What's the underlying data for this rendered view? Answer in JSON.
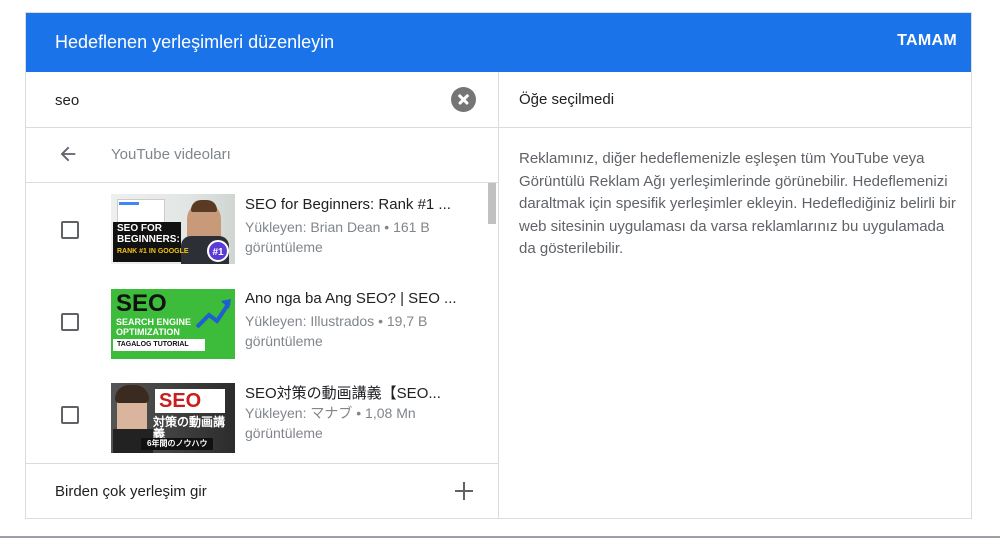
{
  "dialog": {
    "title": "Hedeflenen yerleşimleri düzenleyin",
    "ok_label": "TAMAM"
  },
  "search": {
    "value": "seo"
  },
  "category": {
    "label": "YouTube videoları"
  },
  "videos": [
    {
      "title": "SEO for Beginners: Rank #1 ...",
      "meta": "Yükleyen: Brian Dean • 161 B görüntüleme",
      "thumb_lines": [
        "SEO FOR",
        "BEGINNERS:",
        "RANK #1 IN GOOGLE"
      ],
      "thumb_badge": "#1"
    },
    {
      "title": "Ano nga ba Ang SEO? | SEO ...",
      "meta": "Yükleyen: Illustrados • 19,7 B görüntüleme",
      "thumb_lines": [
        "SEO",
        "SEARCH ENGINE",
        "OPTIMIZATION",
        "TAGALOG TUTORIAL"
      ]
    },
    {
      "title": "SEO対策の動画講義【SEO...",
      "meta": "Yükleyen: マナブ • 1,08 Mn görüntüleme",
      "thumb_lines": [
        "SEO",
        "対策の動画講義",
        "6年間のノウハウ"
      ]
    }
  ],
  "multi_entry": {
    "label": "Birden çok yerleşim gir"
  },
  "selection": {
    "empty_label": "Öğe seçilmedi",
    "info": "Reklamınız, diğer hedeflemenizle eşleşen tüm YouTube veya Görüntülü Reklam Ağı yerleşimlerinde görünebilir. Hedeflemenizi daraltmak için spesifik yerleşimler ekleyin. Hedeflediğiniz belirli bir web sitesinin uygulaması da varsa reklamlarınız bu uygulamada da gösterilebilir."
  },
  "colors": {
    "header_bg": "#1a73e8",
    "divider": "#dadce0"
  }
}
